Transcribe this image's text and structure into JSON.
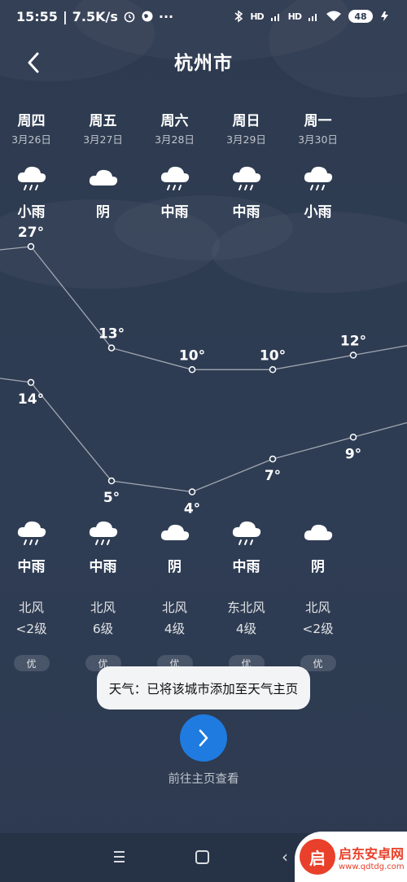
{
  "status_bar": {
    "time": "15:55",
    "speed": "7.5K/s",
    "signal1": "HD",
    "signal2": "HD",
    "battery": "48"
  },
  "header": {
    "title": "杭州市"
  },
  "days": [
    {
      "name": "周四",
      "date": "3月26日",
      "icon": "rain-cloud-icon",
      "cond": "小雨"
    },
    {
      "name": "周五",
      "date": "3月27日",
      "icon": "cloud-icon",
      "cond": "阴"
    },
    {
      "name": "周六",
      "date": "3月28日",
      "icon": "rain-cloud-icon",
      "cond": "中雨"
    },
    {
      "name": "周日",
      "date": "3月29日",
      "icon": "rain-cloud-icon",
      "cond": "中雨"
    },
    {
      "name": "周一",
      "date": "3月30日",
      "icon": "rain-cloud-icon",
      "cond": "小雨"
    }
  ],
  "chart_data": {
    "type": "line",
    "categories": [
      "周四",
      "周五",
      "周六",
      "周日",
      "周一"
    ],
    "series": [
      {
        "values": [
          27,
          13,
          10,
          10,
          12
        ],
        "labels": [
          "27°",
          "13°",
          "10°",
          "10°",
          "12°"
        ]
      },
      {
        "values": [
          14,
          5,
          4,
          7,
          9
        ],
        "labels": [
          "14°",
          "5°",
          "4°",
          "7°",
          "9°"
        ]
      }
    ],
    "ylim": [
      0,
      30
    ]
  },
  "nights": [
    {
      "icon": "rain-cloud-icon",
      "cond": "中雨",
      "wind_dir": "北风",
      "wind_level": "<2级",
      "aqi": "优"
    },
    {
      "icon": "rain-cloud-icon",
      "cond": "中雨",
      "wind_dir": "北风",
      "wind_level": "6级",
      "aqi": "优"
    },
    {
      "icon": "cloud-icon",
      "cond": "阴",
      "wind_dir": "北风",
      "wind_level": "4级",
      "aqi": "优"
    },
    {
      "icon": "rain-cloud-icon",
      "cond": "中雨",
      "wind_dir": "东北风",
      "wind_level": "4级",
      "aqi": "优"
    },
    {
      "icon": "cloud-icon",
      "cond": "阴",
      "wind_dir": "北风",
      "wind_level": "<2级",
      "aqi": "优"
    }
  ],
  "toast": {
    "text": "天气：已将该城市添加至天气主页"
  },
  "goto": {
    "label": "前往主页查看"
  },
  "watermark": {
    "name": "启东安卓网",
    "url": "www.qdtdg.com"
  },
  "colors": {
    "accent": "#1f7be0",
    "background": "#2e3c52",
    "toast": "#f3f4f6"
  }
}
